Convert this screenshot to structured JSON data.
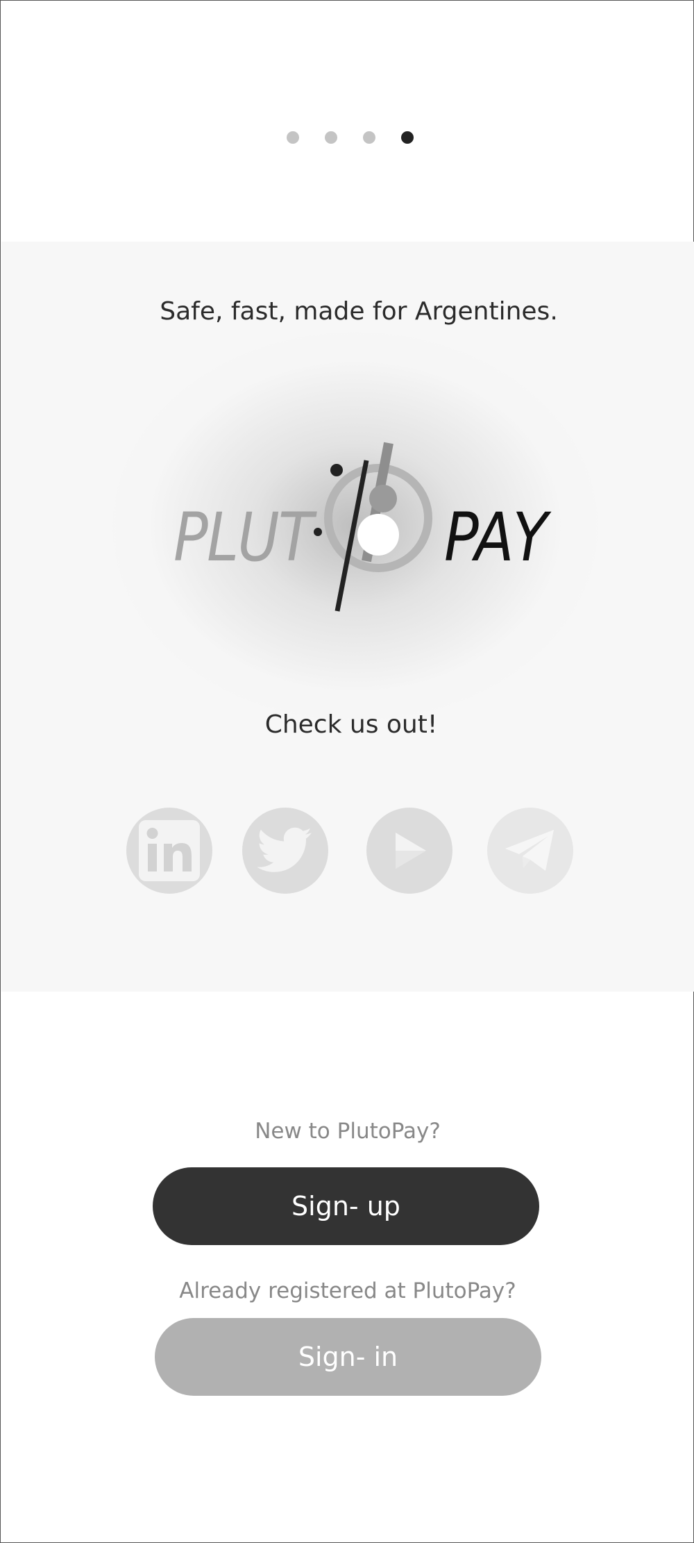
{
  "pager": {
    "total": 4,
    "active_index": 3
  },
  "hero": {
    "tagline": "Safe, fast, made for Argentines.",
    "logo": {
      "left_text": "PLUT",
      "right_text": "PAY"
    },
    "cta_heading": "Check us out!",
    "socials": [
      {
        "name": "linkedin",
        "icon": "linkedin-icon"
      },
      {
        "name": "twitter",
        "icon": "twitter-icon"
      },
      {
        "name": "youtube",
        "icon": "play-icon"
      },
      {
        "name": "telegram",
        "icon": "telegram-icon"
      }
    ]
  },
  "auth": {
    "new_prompt": "New to PlutoPay?",
    "signup_label": "Sign- up",
    "registered_prompt": "Already registered at PlutoPay?",
    "signin_label": "Sign- in"
  },
  "colors": {
    "primary_button": "#333333",
    "secondary_button": "#b1b1b1",
    "hero_background": "#f7f7f7",
    "dot_inactive": "#c4c4c4",
    "dot_active": "#222222"
  }
}
